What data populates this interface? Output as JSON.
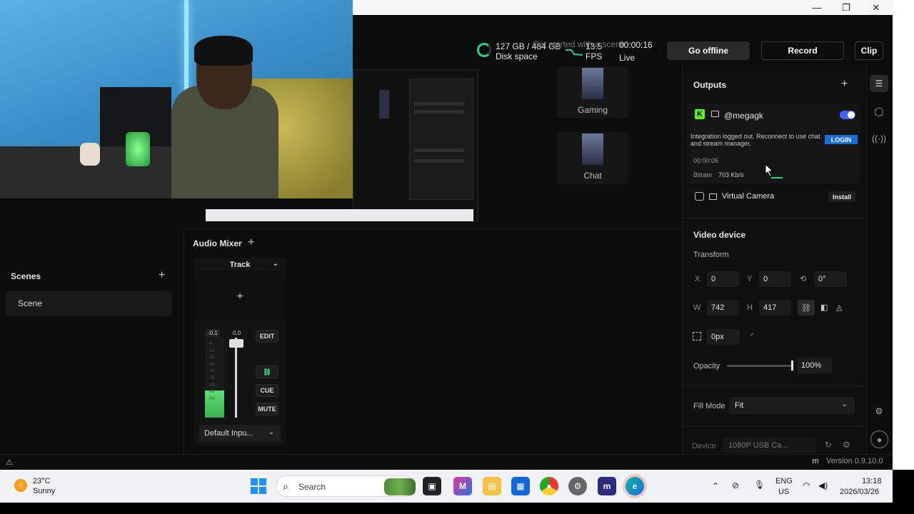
{
  "window": {
    "minimize": "—",
    "maximize": "❐",
    "close": "✕"
  },
  "topbar": {
    "disk_value": "127 GB / 484 GB",
    "disk_label": "Disk space",
    "fps_value": "13.5",
    "fps_label": "FPS",
    "live_time": "00:00:16",
    "live_label": "Live",
    "ghost_text": "Get started with a scene",
    "go_offline": "Go offline",
    "record": "Record",
    "clip": "Clip",
    "accent": "#2ad07e"
  },
  "scene_cards": [
    {
      "label": "Gaming"
    },
    {
      "label": "Chat"
    }
  ],
  "outputs": {
    "title": "Outputs",
    "add": "+",
    "stream": {
      "platform_logo": "K",
      "account": "@megagk",
      "enabled": true,
      "warning": "Integration logged out. Reconnect to use chat and stream manager.",
      "login": "LOGIN",
      "duration": "00:00:06",
      "bitrate_label": "Bitrate",
      "bitrate_value": "703 Kb/s"
    },
    "virtual_camera": {
      "label": "Virtual Camera",
      "install": "Install"
    }
  },
  "properties": {
    "section_title": "Video device",
    "transform_label": "Transform",
    "x_label": "X",
    "x_value": "0",
    "y_label": "Y",
    "y_value": "0",
    "rotation_value": "0°",
    "w_label": "W",
    "w_value": "742",
    "h_label": "H",
    "h_value": "417",
    "padding_value": "0px",
    "opacity_label": "Opacity",
    "opacity_value": "100%",
    "opacity_fraction": 1.0,
    "fill_mode_label": "Fill Mode",
    "fill_mode_value": "Fit",
    "device_label": "Device",
    "device_value": "1080P USB Ca..."
  },
  "scenes": {
    "title": "Scenes",
    "add": "+",
    "items": [
      "Scene"
    ]
  },
  "mixer": {
    "title": "Audio Mixer",
    "add": "+",
    "track_label": "Track",
    "track_add": "+",
    "peak_level": "-0.1",
    "fader_level": "0.0",
    "edit": "EDIT",
    "cue": "CUE",
    "mute": "MUTE",
    "input_device": "Default Inpu...",
    "meter_ticks": [
      "-6",
      "-12",
      "-18",
      "-24",
      "-30",
      "-36",
      "-42",
      "-48",
      "-54"
    ]
  },
  "status": {
    "version": "Version 0.9.10.0"
  },
  "taskbar": {
    "temperature": "23°C",
    "weather": "Sunny",
    "search": "Search",
    "language_line1": "ENG",
    "language_line2": "US",
    "time": "13:18",
    "date": "2026/03/26"
  }
}
